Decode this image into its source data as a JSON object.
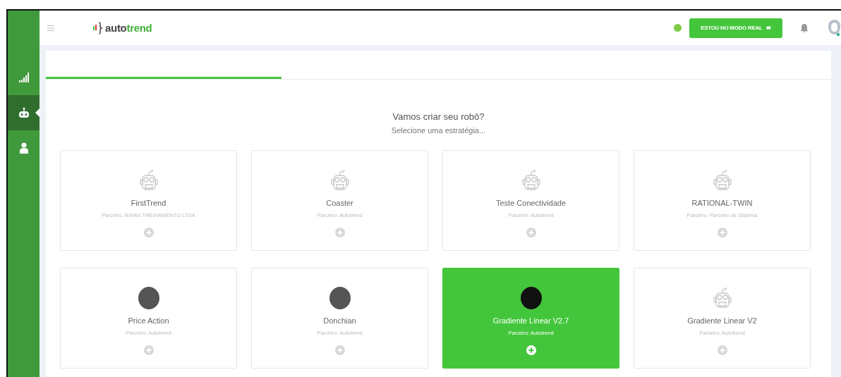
{
  "header": {
    "logo": {
      "dark": "auto",
      "accent": "trend"
    },
    "status_online": true,
    "mode_button": {
      "label": "ESTOU NO MODO REAL",
      "icon": "⇄"
    }
  },
  "sidebar": {
    "items": [
      {
        "kind": "chart",
        "selected": false
      },
      {
        "kind": "robot",
        "selected": true
      },
      {
        "kind": "user",
        "selected": false
      }
    ]
  },
  "progress": {
    "level": 0.3
  },
  "heading": "Vamos criar seu robô?",
  "subheading": "Selecione uma estratégia...",
  "strategies": [
    {
      "name": "FirstTrend",
      "partner": "Parceiro: IEMAX TREINAMENTO LTDA",
      "kind": "robot",
      "selected": false
    },
    {
      "name": "Coaster",
      "partner": "Parceiro: Autotrend",
      "kind": "robot",
      "selected": false
    },
    {
      "name": "Teste Conectividade",
      "partner": "Parceiro: Autotrend",
      "kind": "robot",
      "selected": false
    },
    {
      "name": "RATIONAL-TWIN",
      "partner": "Parceiro: Parceiro de Sistema",
      "kind": "robot",
      "selected": false
    },
    {
      "name": "Price Action",
      "partner": "Parceiro: Autotrend",
      "kind": "photo",
      "selected": false
    },
    {
      "name": "Donchian",
      "partner": "Parceiro: Autotrend",
      "kind": "photo",
      "selected": false
    },
    {
      "name": "Gradiente Linear V2.7",
      "partner": "Parceiro: Autotrend",
      "kind": "photo",
      "selected": true
    },
    {
      "name": "Gradiente Linear V2",
      "partner": "Parceiro: Autotrend",
      "kind": "robot",
      "selected": false
    }
  ]
}
